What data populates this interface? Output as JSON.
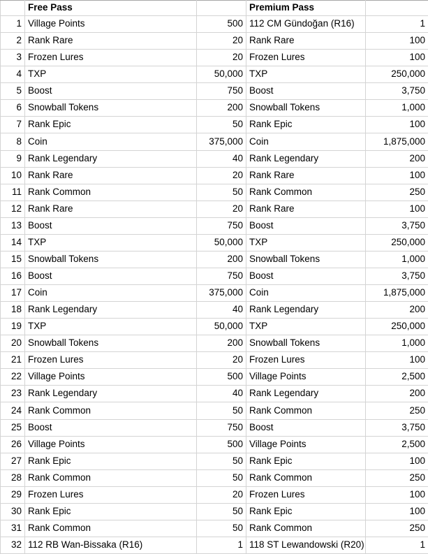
{
  "table": {
    "headers": {
      "index": "",
      "free_name": "Free Pass",
      "free_value": "",
      "premium_name": "Premium Pass",
      "premium_value": ""
    },
    "rows": [
      {
        "index": "1",
        "free_name": "Village Points",
        "free_value": "500",
        "premium_name": "112 CM Gündoğan (R16)",
        "premium_value": "1"
      },
      {
        "index": "2",
        "free_name": "Rank Rare",
        "free_value": "20",
        "premium_name": "Rank Rare",
        "premium_value": "100"
      },
      {
        "index": "3",
        "free_name": "Frozen Lures",
        "free_value": "20",
        "premium_name": "Frozen Lures",
        "premium_value": "100"
      },
      {
        "index": "4",
        "free_name": "TXP",
        "free_value": "50,000",
        "premium_name": "TXP",
        "premium_value": "250,000"
      },
      {
        "index": "5",
        "free_name": "Boost",
        "free_value": "750",
        "premium_name": "Boost",
        "premium_value": "3,750"
      },
      {
        "index": "6",
        "free_name": "Snowball Tokens",
        "free_value": "200",
        "premium_name": "Snowball Tokens",
        "premium_value": "1,000"
      },
      {
        "index": "7",
        "free_name": "Rank Epic",
        "free_value": "50",
        "premium_name": "Rank Epic",
        "premium_value": "100"
      },
      {
        "index": "8",
        "free_name": "Coin",
        "free_value": "375,000",
        "premium_name": "Coin",
        "premium_value": "1,875,000"
      },
      {
        "index": "9",
        "free_name": "Rank Legendary",
        "free_value": "40",
        "premium_name": "Rank Legendary",
        "premium_value": "200"
      },
      {
        "index": "10",
        "free_name": "Rank Rare",
        "free_value": "20",
        "premium_name": "Rank Rare",
        "premium_value": "100"
      },
      {
        "index": "11",
        "free_name": "Rank Common",
        "free_value": "50",
        "premium_name": "Rank Common",
        "premium_value": "250"
      },
      {
        "index": "12",
        "free_name": "Rank Rare",
        "free_value": "20",
        "premium_name": "Rank Rare",
        "premium_value": "100"
      },
      {
        "index": "13",
        "free_name": "Boost",
        "free_value": "750",
        "premium_name": "Boost",
        "premium_value": "3,750"
      },
      {
        "index": "14",
        "free_name": "TXP",
        "free_value": "50,000",
        "premium_name": "TXP",
        "premium_value": "250,000"
      },
      {
        "index": "15",
        "free_name": "Snowball Tokens",
        "free_value": "200",
        "premium_name": "Snowball Tokens",
        "premium_value": "1,000"
      },
      {
        "index": "16",
        "free_name": "Boost",
        "free_value": "750",
        "premium_name": "Boost",
        "premium_value": "3,750"
      },
      {
        "index": "17",
        "free_name": "Coin",
        "free_value": "375,000",
        "premium_name": "Coin",
        "premium_value": "1,875,000"
      },
      {
        "index": "18",
        "free_name": "Rank Legendary",
        "free_value": "40",
        "premium_name": "Rank Legendary",
        "premium_value": "200"
      },
      {
        "index": "19",
        "free_name": "TXP",
        "free_value": "50,000",
        "premium_name": "TXP",
        "premium_value": "250,000"
      },
      {
        "index": "20",
        "free_name": "Snowball Tokens",
        "free_value": "200",
        "premium_name": "Snowball Tokens",
        "premium_value": "1,000"
      },
      {
        "index": "21",
        "free_name": "Frozen Lures",
        "free_value": "20",
        "premium_name": "Frozen Lures",
        "premium_value": "100"
      },
      {
        "index": "22",
        "free_name": "Village Points",
        "free_value": "500",
        "premium_name": "Village Points",
        "premium_value": "2,500"
      },
      {
        "index": "23",
        "free_name": "Rank Legendary",
        "free_value": "40",
        "premium_name": "Rank Legendary",
        "premium_value": "200"
      },
      {
        "index": "24",
        "free_name": "Rank Common",
        "free_value": "50",
        "premium_name": "Rank Common",
        "premium_value": "250"
      },
      {
        "index": "25",
        "free_name": "Boost",
        "free_value": "750",
        "premium_name": "Boost",
        "premium_value": "3,750"
      },
      {
        "index": "26",
        "free_name": "Village Points",
        "free_value": "500",
        "premium_name": "Village Points",
        "premium_value": "2,500"
      },
      {
        "index": "27",
        "free_name": "Rank Epic",
        "free_value": "50",
        "premium_name": "Rank Epic",
        "premium_value": "100"
      },
      {
        "index": "28",
        "free_name": "Rank Common",
        "free_value": "50",
        "premium_name": "Rank Common",
        "premium_value": "250"
      },
      {
        "index": "29",
        "free_name": "Frozen Lures",
        "free_value": "20",
        "premium_name": "Frozen Lures",
        "premium_value": "100"
      },
      {
        "index": "30",
        "free_name": "Rank Epic",
        "free_value": "50",
        "premium_name": "Rank Epic",
        "premium_value": "100"
      },
      {
        "index": "31",
        "free_name": "Rank Common",
        "free_value": "50",
        "premium_name": "Rank Common",
        "premium_value": "250"
      },
      {
        "index": "32",
        "free_name": "112 RB Wan-Bissaka (R16)",
        "free_value": "1",
        "premium_name": "118 ST Lewandowski (R20)",
        "premium_value": "1"
      }
    ]
  }
}
